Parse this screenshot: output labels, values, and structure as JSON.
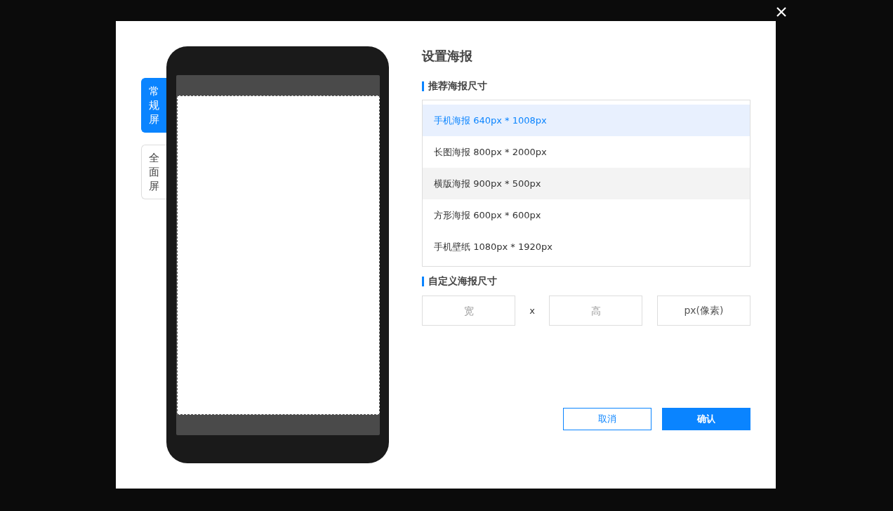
{
  "screen_tabs": [
    {
      "label": "常规屏",
      "selected": true
    },
    {
      "label": "全面屏",
      "selected": false
    }
  ],
  "dialog": {
    "title": "设置海报",
    "recommended": {
      "heading": "推荐海报尺寸",
      "items": [
        {
          "label": "手机海报 640px * 1008px",
          "selected": true,
          "hovered": false
        },
        {
          "label": "长图海报 800px * 2000px",
          "selected": false,
          "hovered": false
        },
        {
          "label": "横版海报 900px * 500px",
          "selected": false,
          "hovered": true
        },
        {
          "label": "方形海报 600px * 600px",
          "selected": false,
          "hovered": false
        },
        {
          "label": "手机壁纸 1080px * 1920px",
          "selected": false,
          "hovered": false
        }
      ]
    },
    "custom": {
      "heading": "自定义海报尺寸",
      "width": {
        "placeholder": "宽"
      },
      "separator": "x",
      "height": {
        "placeholder": "高"
      },
      "unit": "px(像素)"
    },
    "buttons": [
      {
        "label": "取消",
        "kind": "secondary"
      },
      {
        "label": "确认",
        "kind": "primary"
      }
    ]
  }
}
